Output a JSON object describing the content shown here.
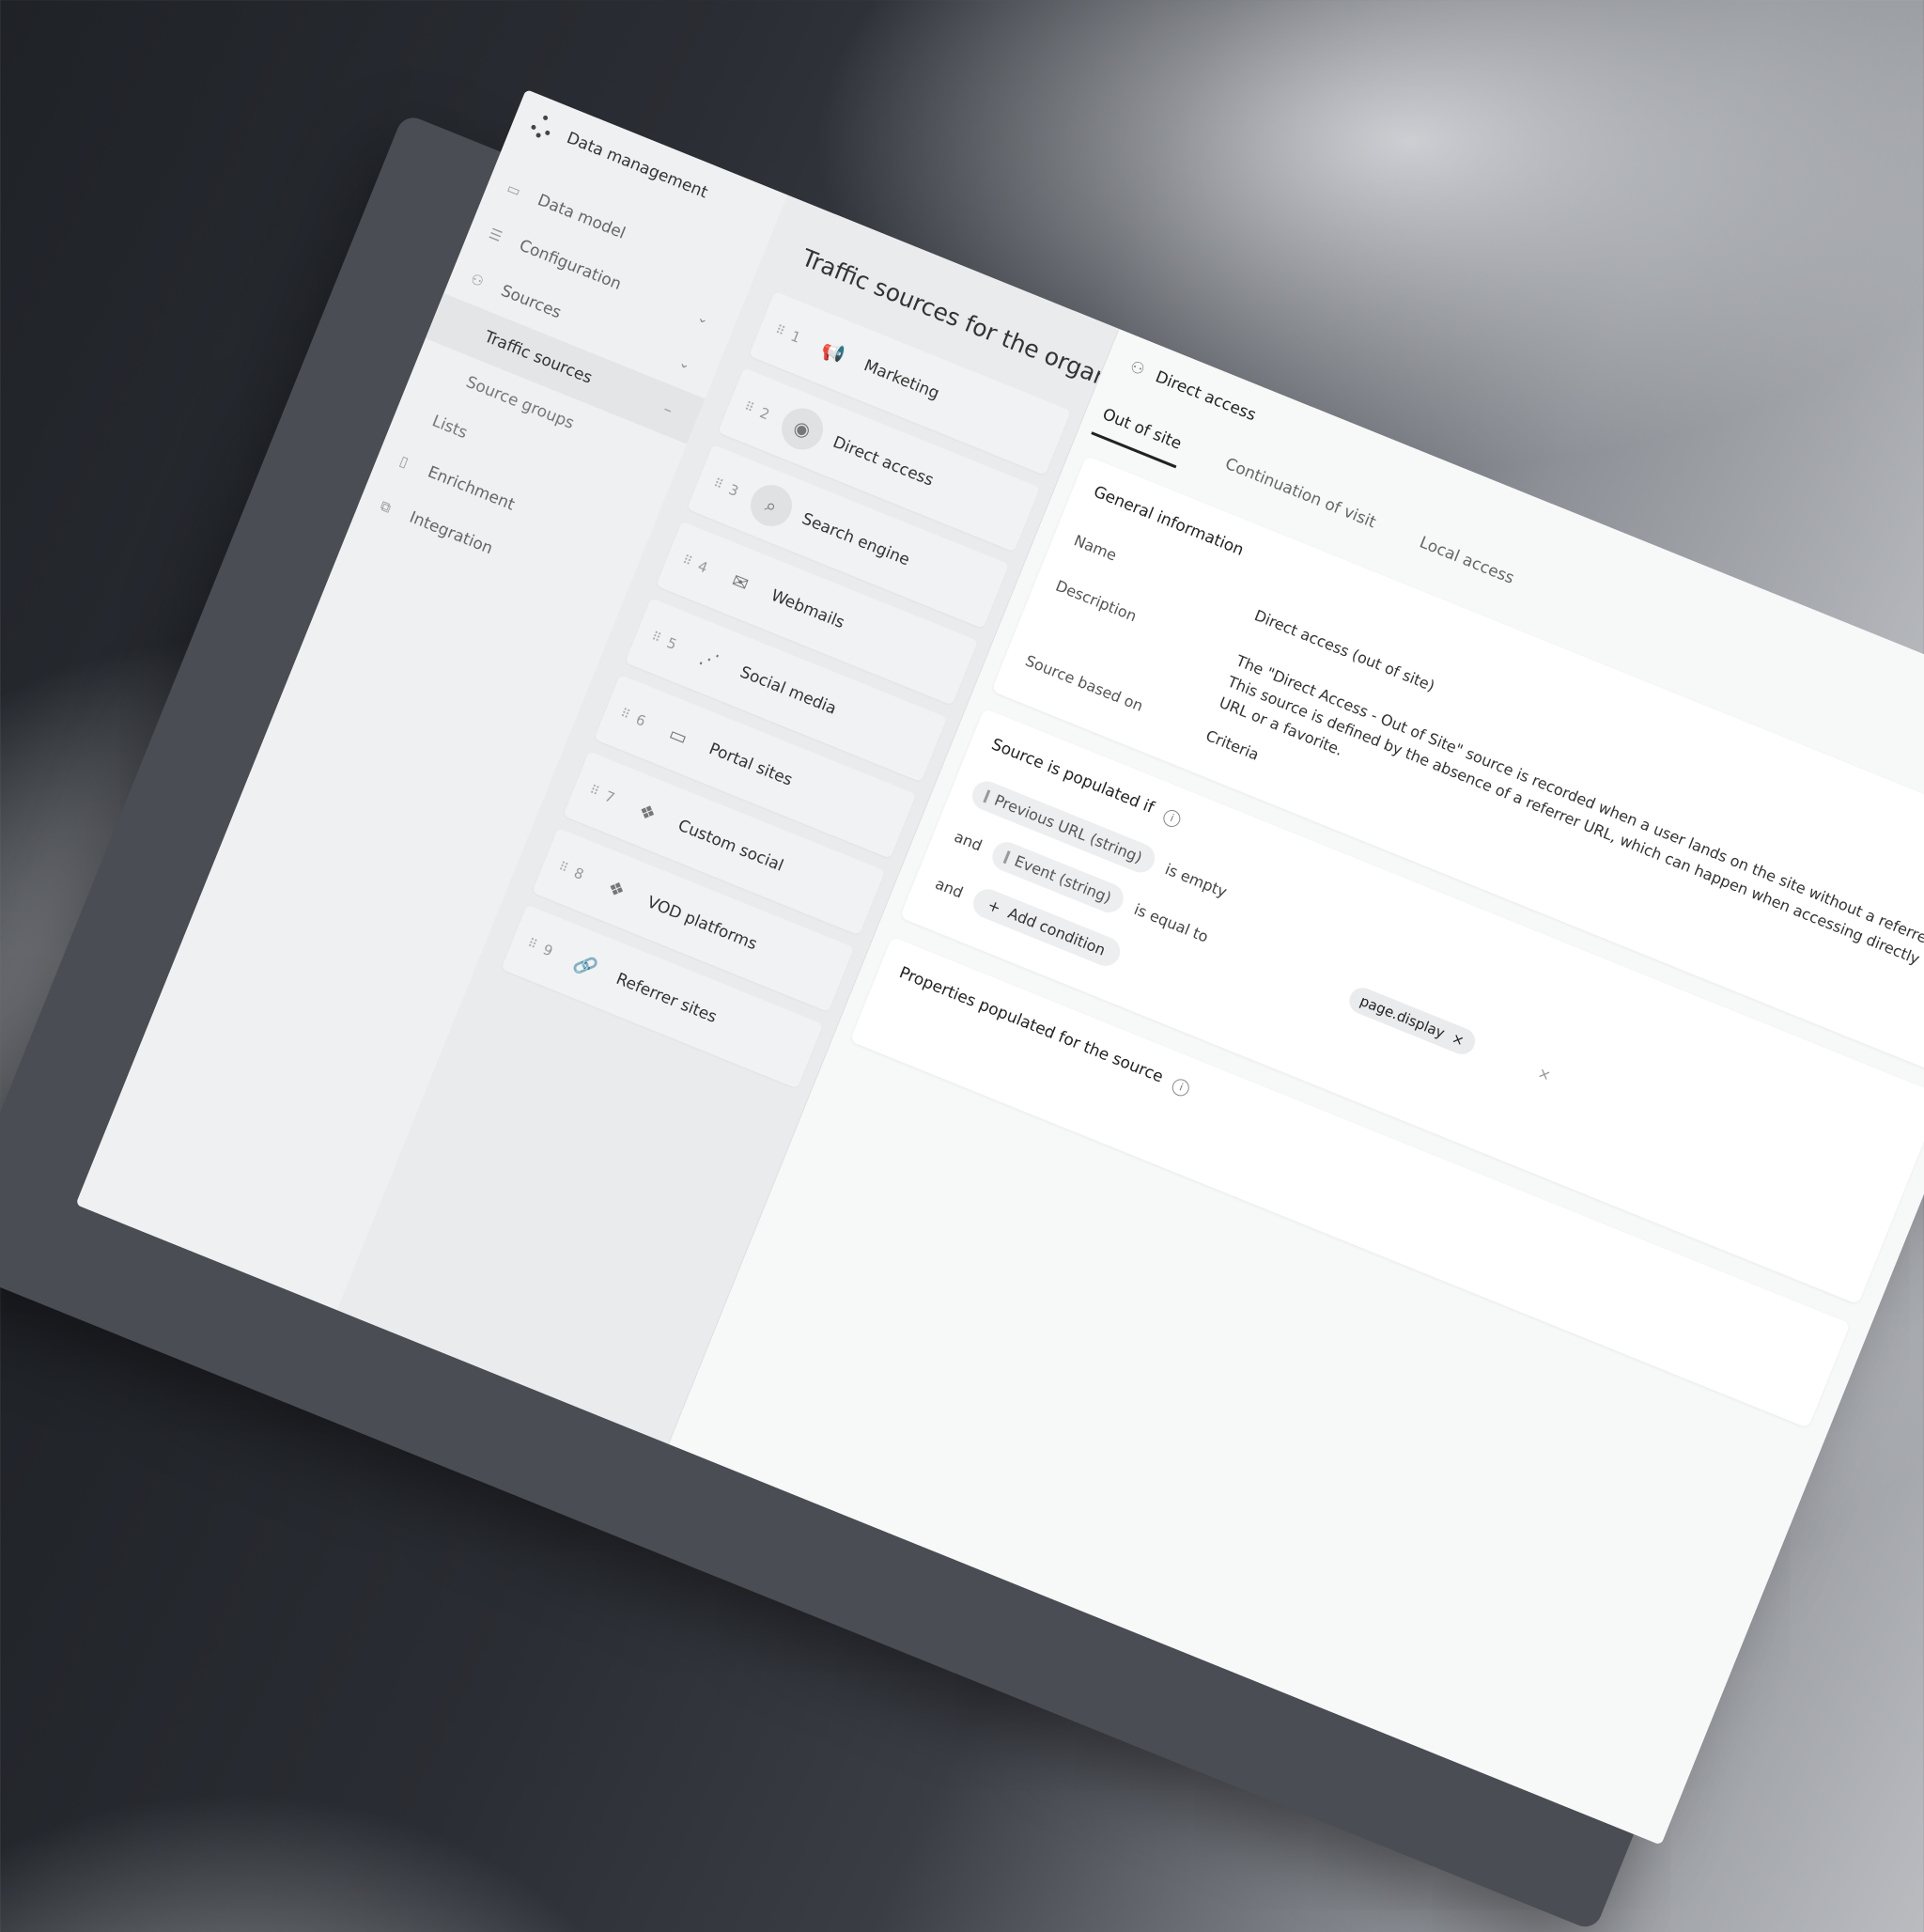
{
  "app": {
    "title": "Data management"
  },
  "nav": {
    "items": [
      {
        "label": "Data model",
        "icon": "book-icon"
      },
      {
        "label": "Configuration",
        "icon": "sliders-icon"
      },
      {
        "label": "Sources",
        "icon": "circles-icon"
      }
    ],
    "sources_sub": [
      {
        "label": "Traffic sources"
      },
      {
        "label": "Source groups"
      },
      {
        "label": "Lists"
      }
    ],
    "more": [
      {
        "label": "Enrichment",
        "icon": "panel-icon"
      },
      {
        "label": "Integration",
        "icon": "integration-icon"
      }
    ]
  },
  "list": {
    "title": "Traffic sources for the organization",
    "rows": [
      {
        "num": "1",
        "label": "Marketing",
        "icon": "megaphone-icon"
      },
      {
        "num": "2",
        "label": "Direct access",
        "icon": "target-icon"
      },
      {
        "num": "3",
        "label": "Search engine",
        "icon": "search-icon"
      },
      {
        "num": "4",
        "label": "Webmails",
        "icon": "envelope-icon"
      },
      {
        "num": "5",
        "label": "Social media",
        "icon": "share-icon"
      },
      {
        "num": "6",
        "label": "Portal sites",
        "icon": "portal-icon"
      },
      {
        "num": "7",
        "label": "Custom social",
        "icon": "cubes-icon"
      },
      {
        "num": "8",
        "label": "VOD platforms",
        "icon": "cubes-icon"
      },
      {
        "num": "9",
        "label": "Referrer sites",
        "icon": "link-icon"
      }
    ]
  },
  "detail": {
    "title": "Direct access",
    "tabs": [
      "Out of site",
      "Continuation of visit",
      "Local access"
    ],
    "general": {
      "title": "General information",
      "name_label": "Name",
      "name_value": "Direct access (out of site)",
      "description_label": "Description",
      "description_value": "The \"Direct Access - Out of Site\" source is recorded when a user lands on the site without a referrer URL. This source is defined by the absence of a referrer URL, which can happen when accessing directly with its URL or a favorite.",
      "based_label": "Source based on",
      "based_value": "Criteria"
    },
    "conditions": {
      "title": "Source is populated if",
      "rows": [
        {
          "prefix": "",
          "field": "Previous URL (string)",
          "op": "is empty"
        },
        {
          "prefix": "and",
          "field": "Event (string)",
          "op": "is equal to"
        }
      ],
      "add_prefix": "and",
      "add_label": "Add condition",
      "tag_value": "page.display"
    },
    "properties": {
      "title": "Properties populated for the source"
    }
  }
}
